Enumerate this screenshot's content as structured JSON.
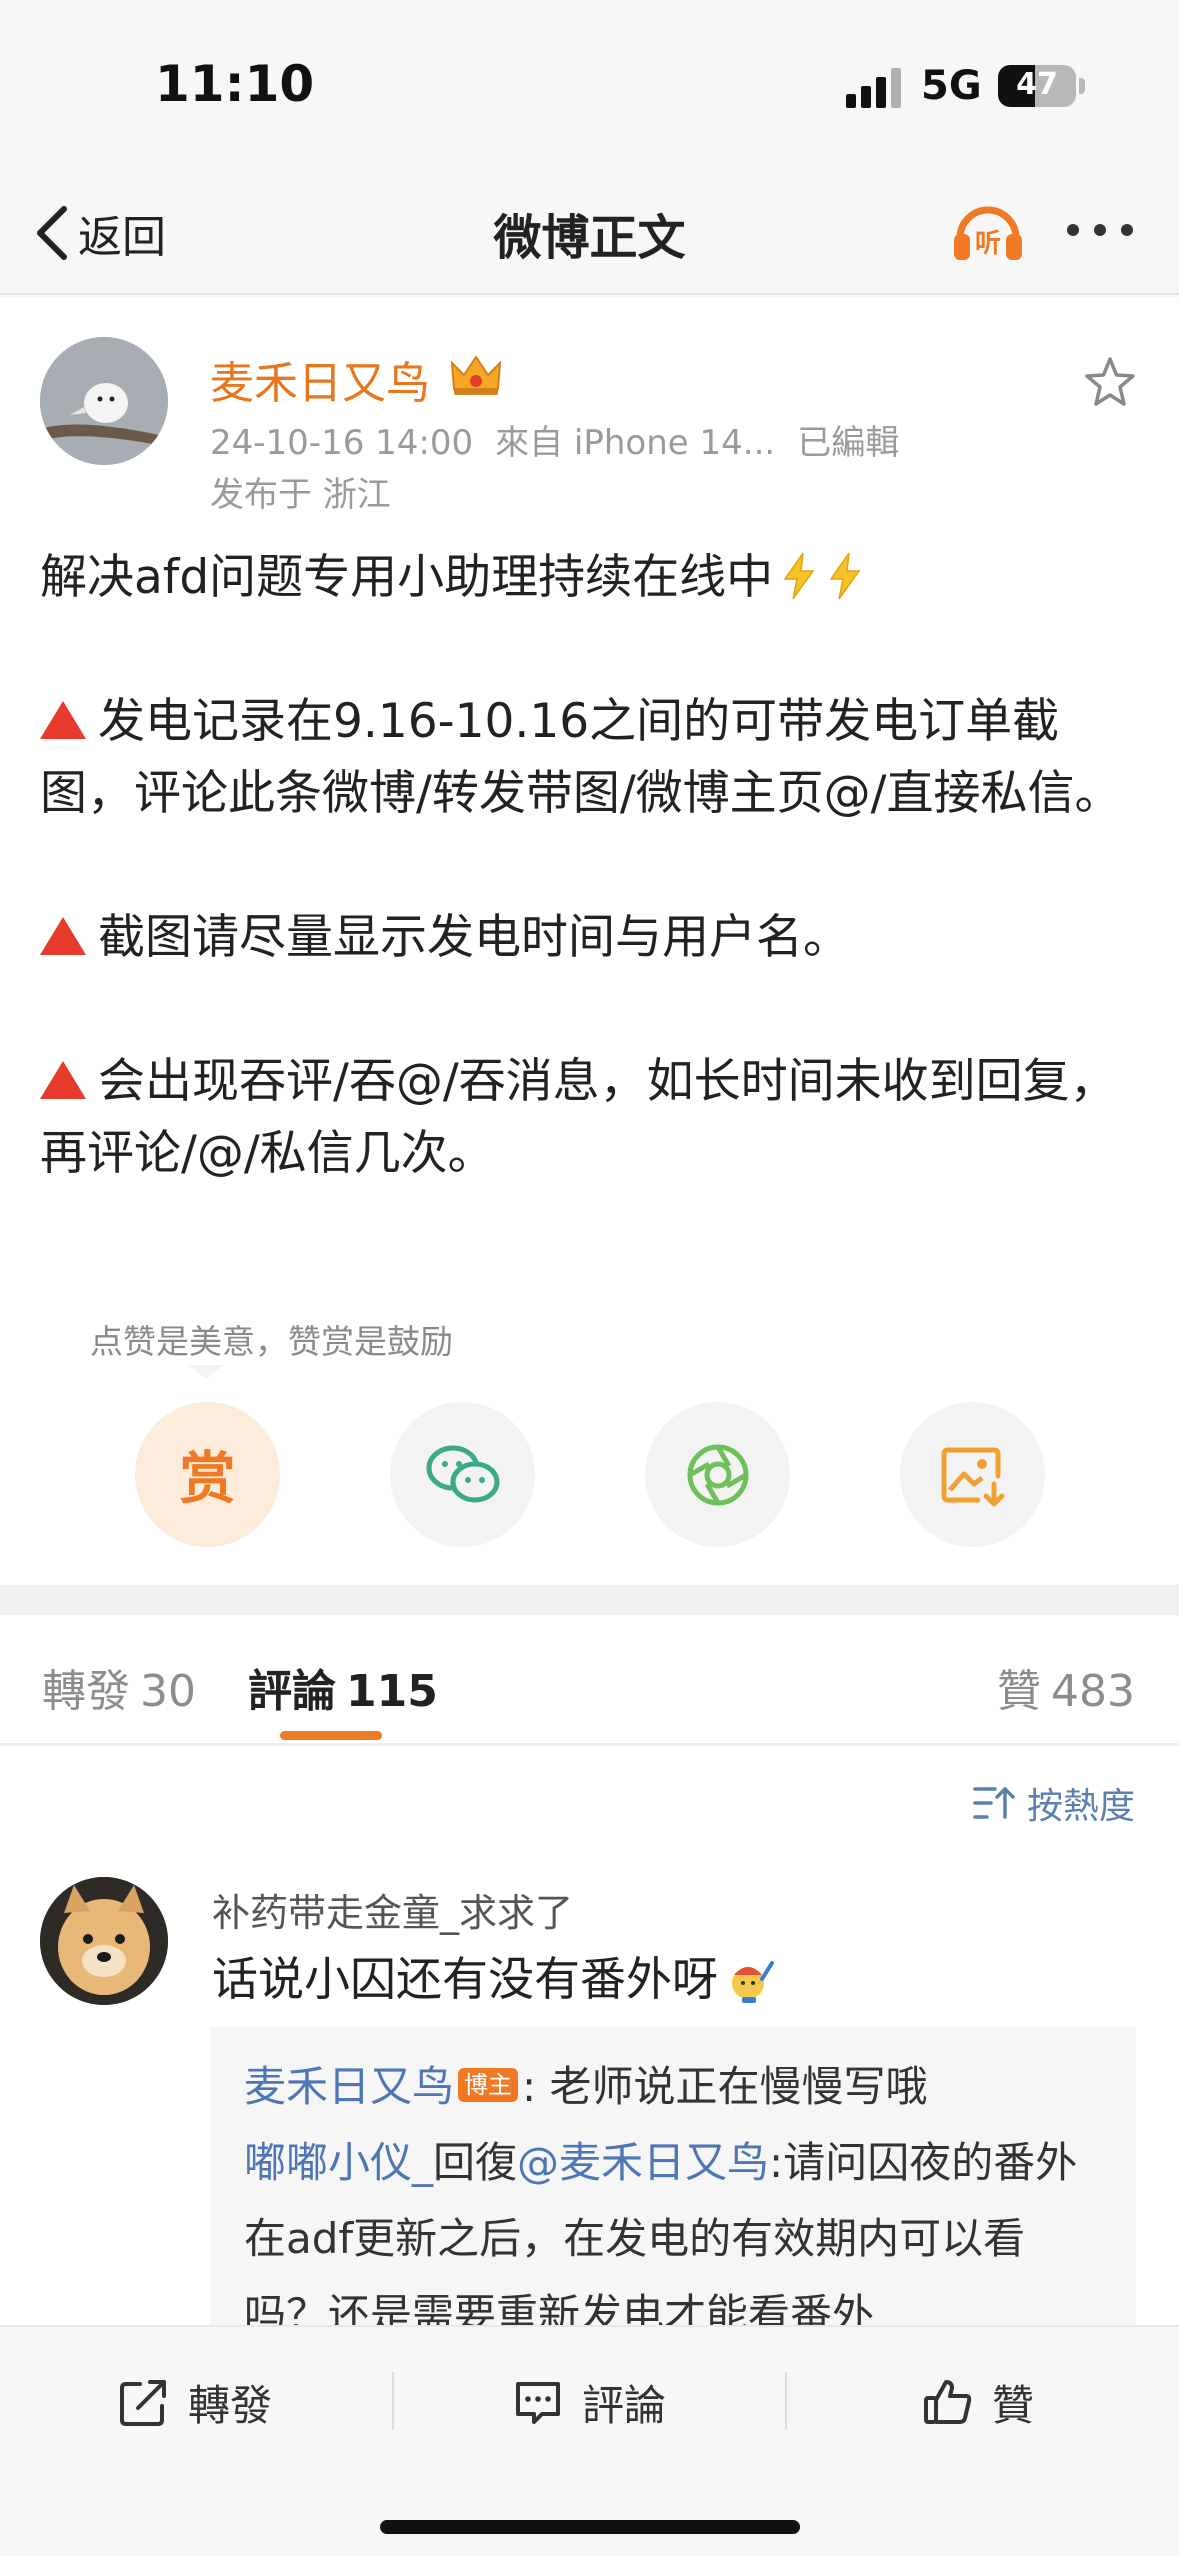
{
  "status_bar": {
    "time": "11:10",
    "network": "5G",
    "battery": "47",
    "battery_fraction": 0.47
  },
  "nav": {
    "back_label": "返回",
    "title": "微博正文",
    "listen_icon": "headphones-listen-icon",
    "listen_label": "听",
    "more_icon": "more-dots-icon"
  },
  "post": {
    "author": "麦禾日又鸟",
    "date": "24-10-16 14:00",
    "source": "來自 iPhone 14...",
    "edited": "已編輯",
    "location": "发布于 浙江",
    "line1": "解决afd问题专用小助理持续在线中",
    "para2": "发电记录在9.16-10.16之间的可带发电订单截图，评论此条微博/转发带图/微博主页@/直接私信。",
    "para3": "截图请尽量显示发电时间与用户名。",
    "para4": "会出现吞评/吞@/吞消息，如长时间未收到回复，再评论/@/私信几次。",
    "reward_tip": "点赞是美意，赞赏是鼓励",
    "reward_label": "赏",
    "accent": "#f07a24"
  },
  "tabs": {
    "repost_label": "轉發",
    "repost_count": "30",
    "comment_label": "評論",
    "comment_count": "115",
    "like_label": "贊",
    "like_count": "483"
  },
  "comments": {
    "sort_label": "按熱度",
    "items": [
      {
        "user": "补药带走金童_求求了",
        "text": "话说小囚还有没有番外呀",
        "replies": [
          {
            "user": "麦禾日又鸟",
            "badge": "博主",
            "text": ": 老师说正在慢慢写哦"
          },
          {
            "user": "嘟嘟小仪_",
            "reply_word": "回復",
            "mention": "@麦禾日又鸟",
            "text": ":请问囚夜的番外在adf更新之后，在发电的有效期内可以看吗？还是需要重新发电才能看番外"
          }
        ]
      }
    ]
  },
  "bottom_bar": {
    "repost": "轉發",
    "comment": "評論",
    "like": "贊"
  }
}
